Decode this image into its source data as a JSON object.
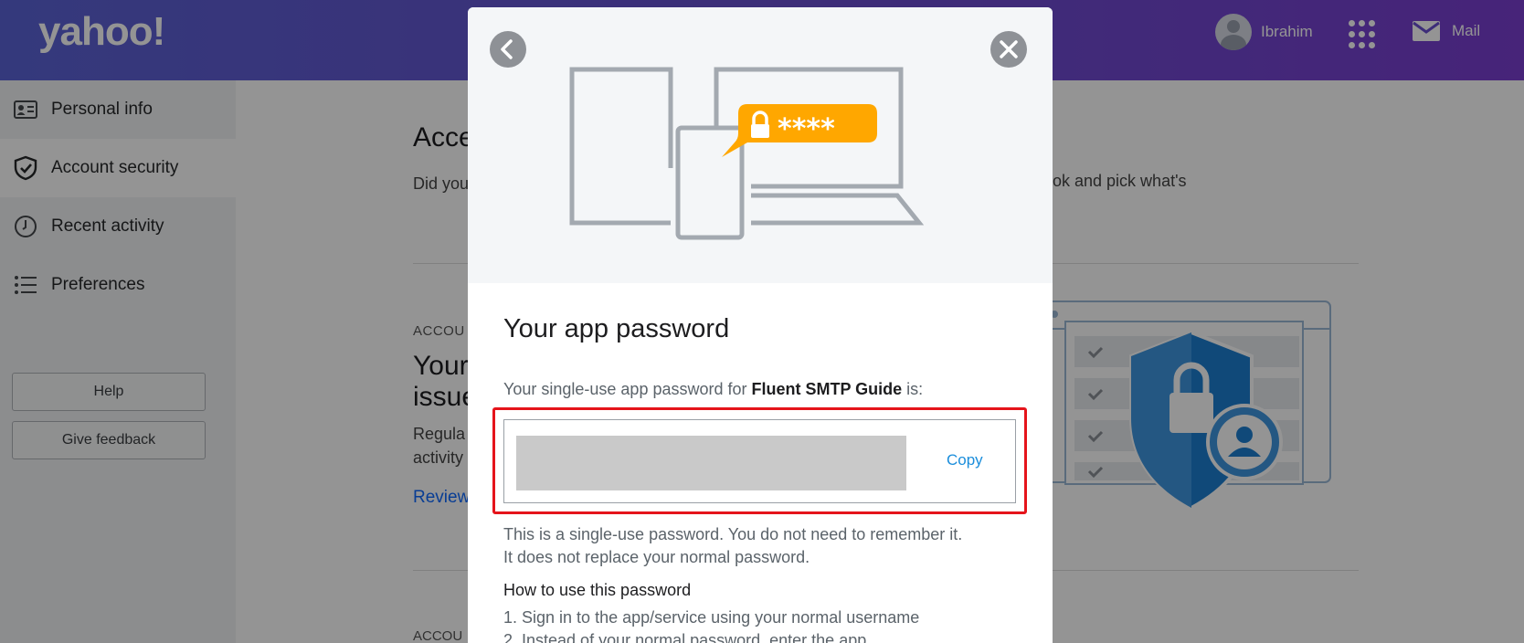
{
  "header": {
    "logo": "yahoo!",
    "user_name": "Ibrahim",
    "mail_label": "Mail"
  },
  "sidebar": {
    "items": [
      {
        "label": "Personal info",
        "icon": "id-card-icon",
        "active": false
      },
      {
        "label": "Account security",
        "icon": "shield-check-icon",
        "active": true
      },
      {
        "label": "Recent activity",
        "icon": "clock-icon",
        "active": false
      },
      {
        "label": "Preferences",
        "icon": "list-icon",
        "active": false
      }
    ],
    "help_label": "Help",
    "feedback_label": "Give feedback"
  },
  "main": {
    "title": "Acce",
    "desc_left": "Did you best fo",
    "desc_right": "ok and pick what's",
    "section_label": "ACCOU",
    "section_heading": "Your issue",
    "section_text": "Regula activity",
    "review_link": "Review",
    "section_label_2": "ACCOU"
  },
  "modal": {
    "title": "Your app password",
    "subtitle_prefix": "Your single-use app password for ",
    "app_name": "Fluent SMTP Guide",
    "subtitle_suffix": " is:",
    "copy_label": "Copy",
    "note_line1": "This is a single-use password. You do not need to remember it.",
    "note_line2": "It does not replace your normal password.",
    "howto_heading": "How to use this password",
    "step1": "1. Sign in to the app/service using your normal username",
    "step2": "2. Instead of your normal password, enter the app"
  },
  "colors": {
    "header_start": "#5b63d6",
    "header_end": "#7a3ed0",
    "highlight_border": "#e5141b",
    "copy_link": "#1a8ddb",
    "lock_badge": "#ffa700"
  }
}
